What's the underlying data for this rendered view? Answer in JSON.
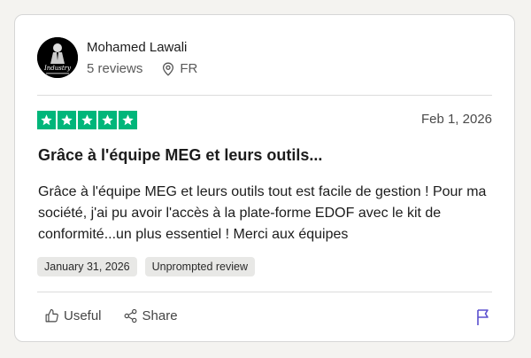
{
  "reviewer": {
    "name": "Mohamed Lawali",
    "reviews_count": "5 reviews",
    "country": "FR",
    "avatar_text": "Industry"
  },
  "review": {
    "rating": 5,
    "max_rating": 5,
    "date": "Feb 1, 2026",
    "title": "Grâce à l'équipe MEG et leurs outils...",
    "body": "Grâce à l'équipe MEG et leurs outils tout est facile de gestion ! Pour ma société, j'ai pu avoir l'accès à la plate-forme EDOF avec le kit de conformité...un plus essentiel ! Merci aux équipes",
    "tags": [
      "January 31, 2026",
      "Unprompted review"
    ]
  },
  "actions": {
    "useful_label": "Useful",
    "share_label": "Share"
  },
  "colors": {
    "star_green": "#00b67a",
    "card_border": "#d6d6d6",
    "tag_bg": "#e8e8e6"
  },
  "icons": [
    "location-pin-icon",
    "star-icon",
    "thumbs-up-icon",
    "share-icon",
    "flag-icon"
  ]
}
